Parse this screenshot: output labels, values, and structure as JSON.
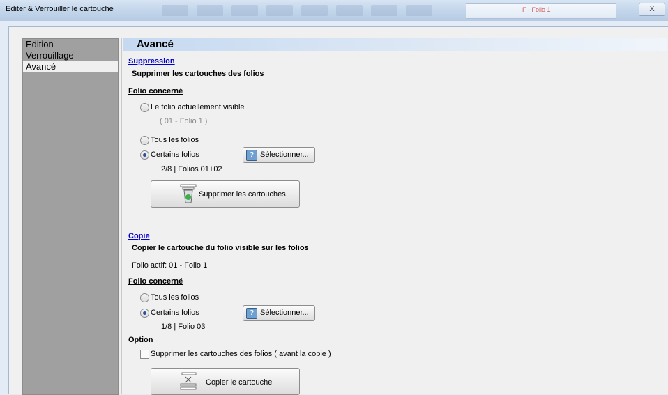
{
  "window": {
    "title": "Editer & Verrouiller le cartouche",
    "close_label": "X",
    "background_field_text": "F - Folio 1"
  },
  "nav": {
    "items": [
      {
        "label": "Edition",
        "selected": false
      },
      {
        "label": "Verrouillage",
        "selected": false
      },
      {
        "label": "Avancé",
        "selected": true
      }
    ]
  },
  "panel": {
    "title": "Avancé"
  },
  "suppression": {
    "section_label": "Suppression",
    "description": "Supprimer les cartouches des folios",
    "folio_heading": "Folio concerné",
    "options": [
      {
        "label": "Le folio actuellement visible",
        "checked": false
      },
      {
        "label": "Tous les folios",
        "checked": false
      },
      {
        "label": "Certains folios",
        "checked": true
      }
    ],
    "visible_folio": "( 01 - Folio 1 )",
    "select_button": "Sélectionner...",
    "selection_summary": "2/8  |  Folios 01+02",
    "action_button": "Supprimer les cartouches"
  },
  "copie": {
    "section_label": "Copie",
    "description": "Copier le cartouche du folio visible sur les folios",
    "active_folio": "Folio actif: 01 - Folio 1",
    "folio_heading": "Folio concerné",
    "options": [
      {
        "label": "Tous les folios",
        "checked": false
      },
      {
        "label": "Certains folios",
        "checked": true
      }
    ],
    "select_button": "Sélectionner...",
    "selection_summary": "1/8  |  Folio 03",
    "option_heading": "Option",
    "option_checkbox": {
      "label": "Supprimer les cartouches des folios ( avant la copie )",
      "checked": false
    },
    "action_button": "Copier le cartouche"
  }
}
